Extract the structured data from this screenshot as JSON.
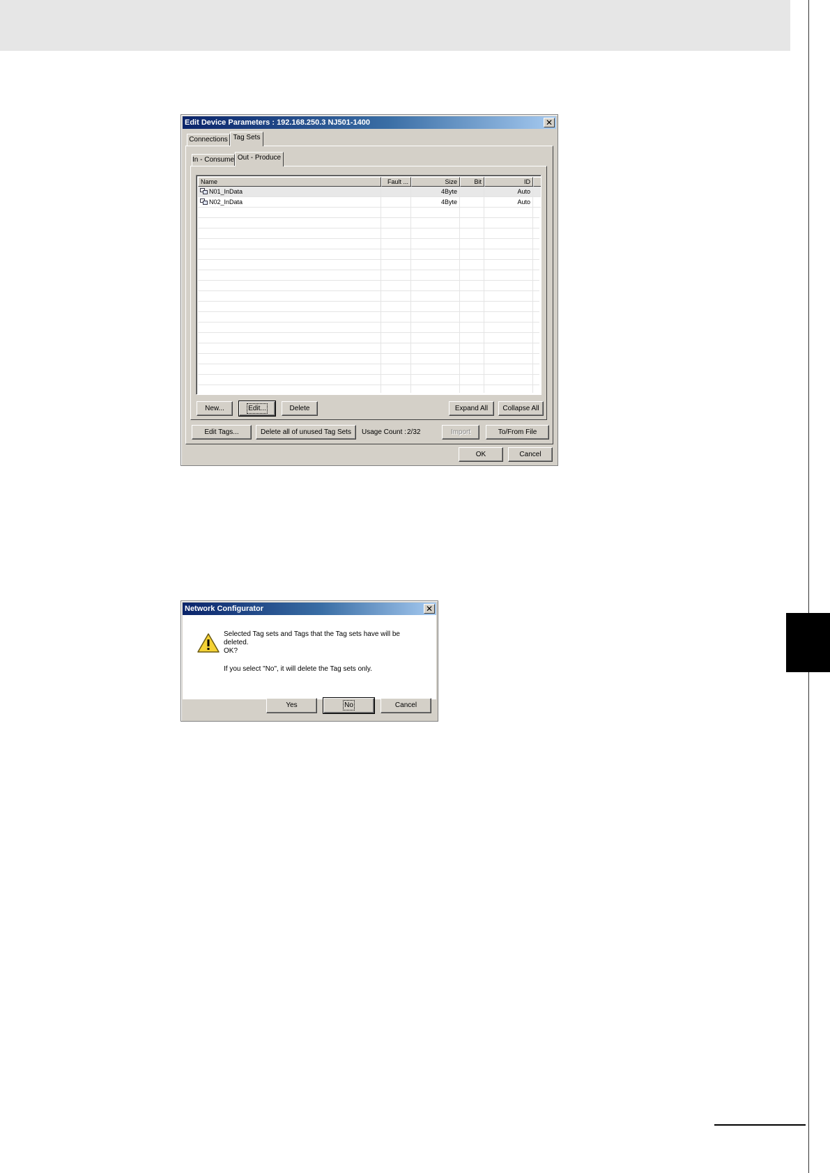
{
  "edit_dialog": {
    "title": "Edit Device Parameters : 192.168.250.3 NJ501-1400",
    "close_glyph": "✕",
    "tabs": [
      "Connections",
      "Tag Sets"
    ],
    "subtabs": [
      "In - Consume",
      "Out - Produce"
    ],
    "columns": [
      "Name",
      "Fault ...",
      "Size",
      "Bit",
      "ID"
    ],
    "rows": [
      {
        "name": "N01_InData",
        "fault": "",
        "size": "4Byte",
        "bit": "",
        "id": "Auto"
      },
      {
        "name": "N02_InData",
        "fault": "",
        "size": "4Byte",
        "bit": "",
        "id": "Auto"
      }
    ],
    "buttons": {
      "new": "New...",
      "edit": "Edit...",
      "delete": "Delete",
      "expand_all": "Expand All",
      "collapse_all": "Collapse All",
      "edit_tags": "Edit Tags...",
      "delete_unused": "Delete all of unused Tag Sets",
      "import": "Import",
      "to_from_file": "To/From File",
      "ok": "OK",
      "cancel": "Cancel"
    },
    "usage_count_label": "Usage Count :",
    "usage_count_value": "2/32"
  },
  "confirm_dialog": {
    "title": "Network Configurator",
    "close_glyph": "✕",
    "icon": "warning-icon",
    "message_line1": "Selected Tag sets and Tags that the Tag sets have will be",
    "message_line2": "deleted.",
    "message_line3": "OK?",
    "message_line4": "If you select \"No\", it will delete the Tag sets only.",
    "buttons": {
      "yes": "Yes",
      "no": "No",
      "cancel": "Cancel"
    }
  }
}
